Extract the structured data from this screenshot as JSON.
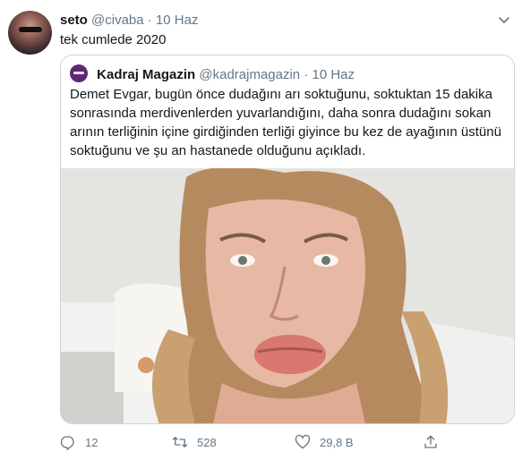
{
  "tweet": {
    "author_name": "seto",
    "author_handle": "@civaba",
    "separator": "·",
    "date": "10 Haz",
    "text": "tek cumlede 2020"
  },
  "quoted": {
    "author_name": "Kadraj Magazin",
    "author_handle": "@kadrajmagazin",
    "separator": "·",
    "date": "10 Haz",
    "text": "Demet Evgar, bugün önce dudağını arı soktuğunu, soktuktan 15 dakika sonrasında merdivenlerden yuvarlandığını, daha sonra dudağını sokan arının terliğinin içine girdiğinden terliği giyince bu kez de ayağının üstünü soktuğunu ve şu an hastanede olduğunu açıkladı."
  },
  "actions": {
    "reply_count": "12",
    "retweet_count": "528",
    "like_count": "29,8 B"
  },
  "icons": {
    "caret": "chevron-down-icon",
    "reply": "reply-icon",
    "retweet": "retweet-icon",
    "like": "heart-icon",
    "share": "share-icon"
  },
  "colors": {
    "text": "#14171a",
    "secondary": "#657786",
    "border": "#ccd6dd",
    "quoted_avatar": "#5b2a6e"
  }
}
